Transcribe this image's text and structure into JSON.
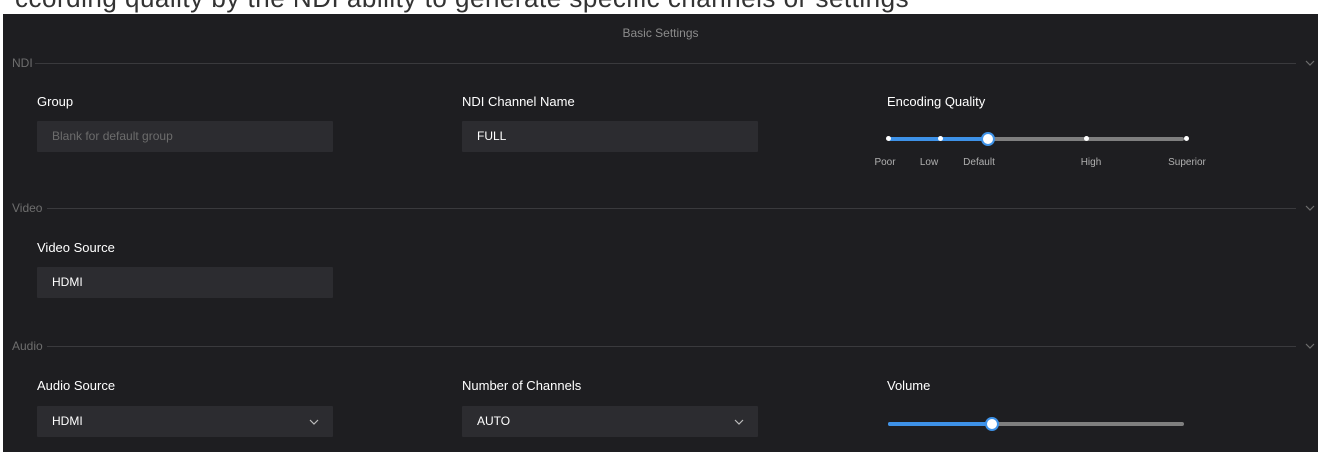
{
  "top_strip_text": "ccording quality by the NDI ability to generate specific channels or settings",
  "panel": {
    "title": "Basic Settings"
  },
  "colors": {
    "accent": "#3e92e8",
    "panel_bg": "#1e1e21",
    "field_bg": "#2c2c30",
    "track": "#7f7f7f"
  },
  "sections": {
    "ndi": {
      "label": "NDI",
      "icon": "chevron-down-icon"
    },
    "video": {
      "label": "Video",
      "icon": "chevron-down-icon"
    },
    "audio": {
      "label": "Audio",
      "icon": "chevron-down-icon"
    }
  },
  "ndi": {
    "group": {
      "label": "Group",
      "value": "",
      "placeholder": "Blank for default group"
    },
    "channel_name": {
      "label": "NDI Channel Name",
      "value": "FULL"
    },
    "encoding_quality": {
      "label": "Encoding Quality",
      "levels": [
        "Poor",
        "Low",
        "Default",
        "High",
        "Superior"
      ],
      "selected": "Default",
      "selected_index": 2
    }
  },
  "video": {
    "source": {
      "label": "Video Source",
      "value": "HDMI"
    }
  },
  "audio": {
    "source": {
      "label": "Audio Source",
      "value": "HDMI",
      "icon": "chevron-down-icon"
    },
    "channels": {
      "label": "Number of Channels",
      "value": "AUTO",
      "icon": "chevron-down-icon"
    },
    "volume": {
      "label": "Volume",
      "fraction": 0.35
    }
  }
}
